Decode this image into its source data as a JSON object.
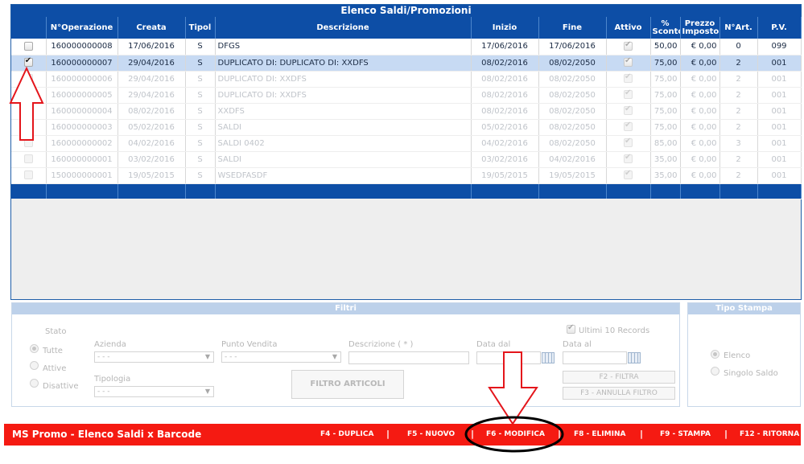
{
  "grid": {
    "title": "Elenco Saldi/Promozioni",
    "columns": [
      "N°Operazione",
      "Creata",
      "Tipol",
      "Descrizione",
      "Inizio",
      "Fine",
      "Attivo",
      "% Sconto",
      "Prezzo Imposto",
      "N°Art.",
      "P.V."
    ],
    "rows": [
      {
        "checked": false,
        "op": "160000000008",
        "created": "17/06/2016",
        "type": "S",
        "desc": "DFGS",
        "start": "17/06/2016",
        "end": "17/06/2016",
        "active": true,
        "discount": "50,00",
        "price": "€ 0,00",
        "items": "0",
        "pv": "099",
        "state": "normal"
      },
      {
        "checked": true,
        "op": "160000000007",
        "created": "29/04/2016",
        "type": "S",
        "desc": "DUPLICATO DI: DUPLICATO DI: XXDFS",
        "start": "08/02/2016",
        "end": "08/02/2050",
        "active": true,
        "discount": "75,00",
        "price": "€ 0,00",
        "items": "2",
        "pv": "001",
        "state": "selected"
      },
      {
        "checked": false,
        "op": "160000000006",
        "created": "29/04/2016",
        "type": "S",
        "desc": "DUPLICATO DI: XXDFS",
        "start": "08/02/2016",
        "end": "08/02/2050",
        "active": true,
        "discount": "75,00",
        "price": "€ 0,00",
        "items": "2",
        "pv": "001",
        "state": "dim"
      },
      {
        "checked": false,
        "op": "160000000005",
        "created": "29/04/2016",
        "type": "S",
        "desc": "DUPLICATO DI: XXDFS",
        "start": "08/02/2016",
        "end": "08/02/2050",
        "active": true,
        "discount": "75,00",
        "price": "€ 0,00",
        "items": "2",
        "pv": "001",
        "state": "dim"
      },
      {
        "checked": false,
        "op": "160000000004",
        "created": "08/02/2016",
        "type": "S",
        "desc": "XXDFS",
        "start": "08/02/2016",
        "end": "08/02/2050",
        "active": true,
        "discount": "75,00",
        "price": "€ 0,00",
        "items": "2",
        "pv": "001",
        "state": "dim"
      },
      {
        "checked": false,
        "op": "160000000003",
        "created": "05/02/2016",
        "type": "S",
        "desc": "SALDI",
        "start": "05/02/2016",
        "end": "08/02/2050",
        "active": true,
        "discount": "75,00",
        "price": "€ 0,00",
        "items": "2",
        "pv": "001",
        "state": "dim"
      },
      {
        "checked": false,
        "op": "160000000002",
        "created": "04/02/2016",
        "type": "S",
        "desc": "SALDI 0402",
        "start": "04/02/2016",
        "end": "08/02/2050",
        "active": true,
        "discount": "85,00",
        "price": "€ 0,00",
        "items": "3",
        "pv": "001",
        "state": "dim"
      },
      {
        "checked": false,
        "op": "160000000001",
        "created": "03/02/2016",
        "type": "S",
        "desc": "SALDI",
        "start": "03/02/2016",
        "end": "04/02/2016",
        "active": true,
        "discount": "35,00",
        "price": "€ 0,00",
        "items": "2",
        "pv": "001",
        "state": "dim"
      },
      {
        "checked": false,
        "op": "150000000001",
        "created": "19/05/2015",
        "type": "S",
        "desc": "WSEDFASDF",
        "start": "19/05/2015",
        "end": "19/05/2015",
        "active": true,
        "discount": "35,00",
        "price": "€ 0,00",
        "items": "2",
        "pv": "001",
        "state": "dim"
      }
    ]
  },
  "filters": {
    "title": "Filtri",
    "stato_label": "Stato",
    "stato_options": [
      "Tutte",
      "Attive",
      "Disattive"
    ],
    "stato_selected": "Tutte",
    "azienda_label": "Azienda",
    "azienda_value": "- - -",
    "tipologia_label": "Tipologia",
    "tipologia_value": "- - -",
    "punto_vendita_label": "Punto Vendita",
    "punto_vendita_value": "- - -",
    "descrizione_label": "Descrizione ( * )",
    "filtro_articoli_label": "FILTRO ARTICOLI",
    "data_dal_label": "Data dal",
    "data_al_label": "Data al",
    "ultimi_label": "Ultimi 10 Records",
    "ultimi_checked": true,
    "filtra_label": "F2 - FILTRA",
    "annulla_label": "F3 - ANNULLA FILTRO"
  },
  "tipo_stampa": {
    "title": "Tipo Stampa",
    "options": [
      "Elenco",
      "Singolo Saldo"
    ],
    "selected": "Elenco"
  },
  "bottom_bar": {
    "title": "MS Promo - Elenco Saldi x Barcode",
    "keys": [
      "F4 - DUPLICA",
      "F5 - NUOVO",
      "F6 - MODIFICA",
      "F8 - ELIMINA",
      "F9 - STAMPA",
      "F12 - RITORNA"
    ],
    "separator": "|"
  },
  "colors": {
    "header_blue": "#0d4ea6",
    "selected_row": "#c7daf3",
    "bottom_bar_red": "#f51a12",
    "annotation_red": "#e4151b"
  }
}
